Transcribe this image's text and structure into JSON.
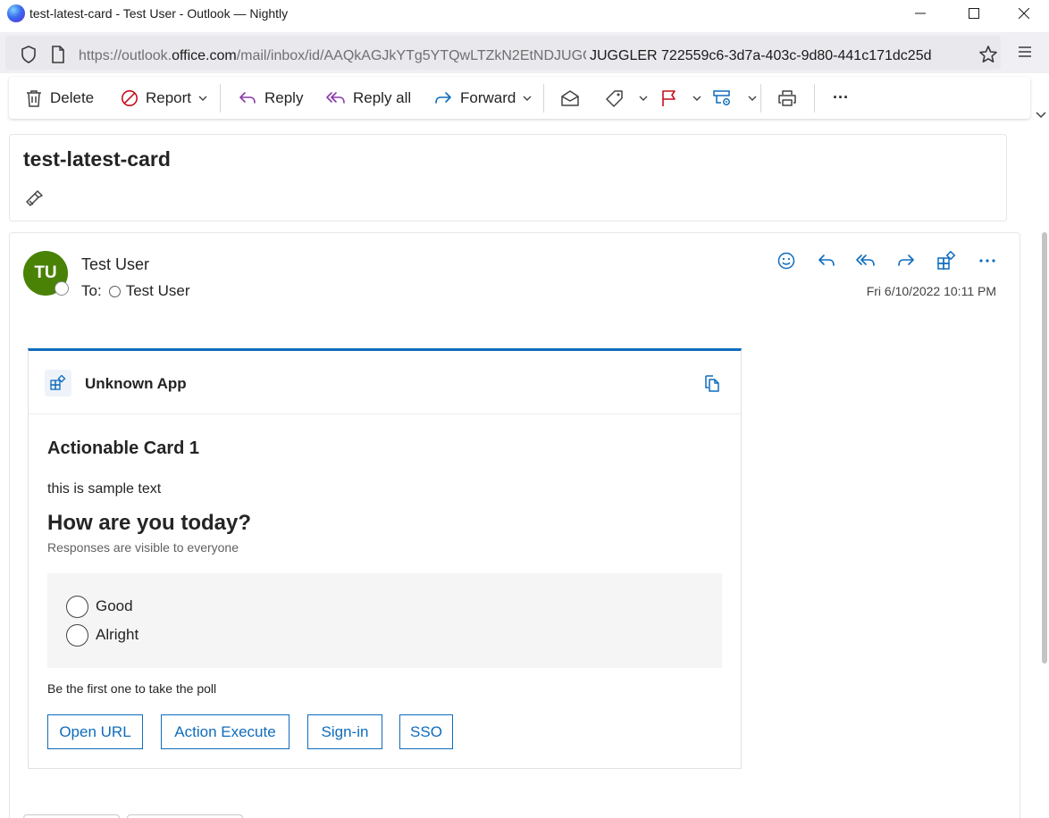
{
  "window": {
    "title": "test-latest-card - Test User - Outlook — Nightly"
  },
  "browser": {
    "url_prefix": "https://outlook.",
    "url_domain": "office.com",
    "url_path": "/mail/inbox/id/AAQkAGJkYTg5YTQwLTZkN2EtNDJUGGLER",
    "url_overlay": "JUGGLER 722559c6-3d7a-403c-9d80-441c171dc25d"
  },
  "toolbar": {
    "delete": "Delete",
    "report": "Report",
    "reply": "Reply",
    "reply_all": "Reply all",
    "forward": "Forward",
    "more": "···"
  },
  "subject": "test-latest-card",
  "message": {
    "avatar_initials": "TU",
    "sender": "Test User",
    "to_label": "To:",
    "recipient": "Test User",
    "date": "Fri 6/10/2022 10:11 PM"
  },
  "card": {
    "app_name": "Unknown App",
    "title": "Actionable Card 1",
    "text": "this is sample text",
    "question": "How are you today?",
    "subtitle": "Responses are visible to everyone",
    "choices": [
      "Good",
      "Alright"
    ],
    "footer": "Be the first one to take the poll",
    "buttons": [
      "Open URL",
      "Action Execute",
      "Sign-in",
      "SSO"
    ]
  },
  "colors": {
    "accent": "#0f6cbd",
    "avatar_bg": "#498205",
    "report_red": "#c50f1f",
    "reply_purple": "#8a3aa8"
  }
}
